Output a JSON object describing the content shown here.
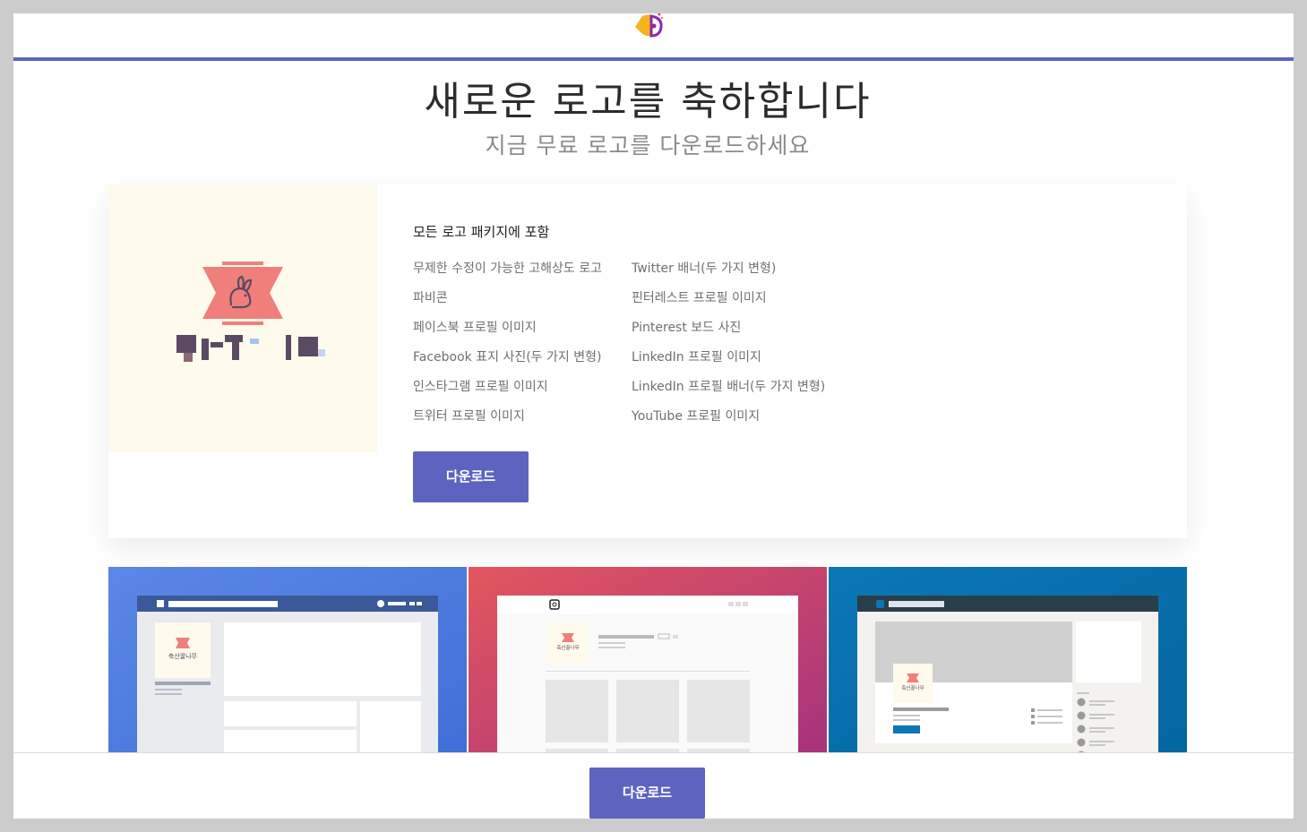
{
  "header": {
    "logo_icon": "bird-head-icon",
    "accent_color": "#5c64bf"
  },
  "hero": {
    "title": "새로운 로고를 축하합니다",
    "subtitle": "지금 무료 로고를 다운로드하세요"
  },
  "package": {
    "title": "모든 로고 패키지에 포함",
    "left_items": [
      "무제한 수정이 가능한 고해상도 로고",
      "파비콘",
      "페이스북 프로필 이미지",
      "Facebook 표지 사진(두 가지 변형)",
      "인스타그램 프로필 이미지",
      "트위터 프로필 이미지"
    ],
    "right_items": [
      "Twitter 배너(두 가지 변형)",
      "핀터레스트 프로필 이미지",
      "Pinterest 보드 사진",
      "LinkedIn 프로필 이미지",
      "LinkedIn 프로필 배너(두 가지 변형)",
      "YouTube 프로필 이미지"
    ],
    "download_label": "다운로드",
    "preview_icon": "rabbit-icon",
    "preview_colors": {
      "background": "#fefaec",
      "ribbon": "#f07f7c",
      "text": "#5b4a63"
    }
  },
  "mockups": [
    {
      "name": "facebook",
      "bg_from": "#5b87e6",
      "bg_to": "#3f6fd6",
      "brand_text": "축산꿀나무"
    },
    {
      "name": "instagram",
      "bg_from": "#e4565e",
      "bg_to": "#a5327e",
      "brand_text": "축산꿀나무"
    },
    {
      "name": "linkedin",
      "bg_from": "#0a77b5",
      "bg_to": "#0665a0",
      "brand_text": "축산꿀나무"
    }
  ],
  "footer": {
    "download_label": "다운로드"
  }
}
